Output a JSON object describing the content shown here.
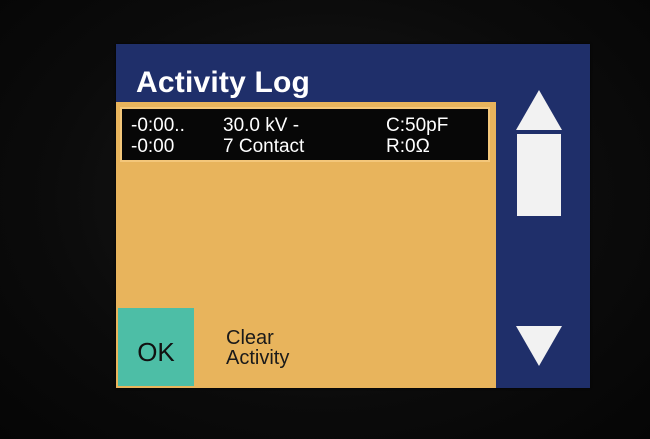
{
  "header": {
    "title": "Activity Log"
  },
  "log_entries": [
    {
      "time_lines": [
        "-0:00..",
        "-0:00"
      ],
      "event_lines": [
        "30.0 kV -",
        "7 Contact"
      ],
      "param_lines": [
        "C:50pF",
        "R:0Ω"
      ]
    }
  ],
  "actions": {
    "ok_label": "OK",
    "clear_lines": [
      "Clear",
      "Activity"
    ]
  },
  "scrollbar": {
    "up_icon": "triangle-up-icon",
    "down_icon": "triangle-down-icon"
  },
  "colors": {
    "screen_bg": "#1f2f6a",
    "panel_bg": "#e8b45c",
    "ok_bg": "#4dbea6",
    "entry_bg": "#070707"
  }
}
